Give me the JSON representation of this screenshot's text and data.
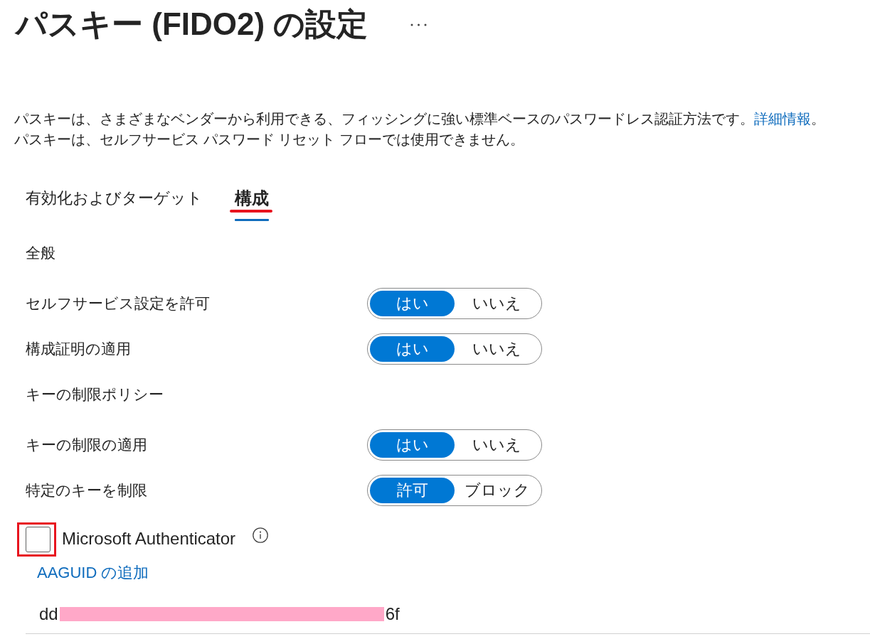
{
  "header": {
    "title": "パスキー (FIDO2) の設定"
  },
  "description": [
    {
      "text": "パスキーは、さまざまなベンダーから利用できる、フィッシングに強い標準ベースのパスワードレス認証方法です。",
      "link": "詳細情報",
      "after_link": "。"
    },
    {
      "text": "パスキーは、セルフサービス パスワード リセット フローでは使用できません。"
    }
  ],
  "tabs": [
    {
      "label": "有効化およびターゲット",
      "selected": false,
      "annotated": false
    },
    {
      "label": "構成",
      "selected": true,
      "annotated": true
    }
  ],
  "settings": [
    {
      "kind": "heading",
      "label": "全般"
    },
    {
      "kind": "toggle",
      "label": "セルフサービス設定を許可",
      "options": [
        {
          "label": "はい",
          "selected": true
        },
        {
          "label": "いいえ",
          "selected": false
        }
      ]
    },
    {
      "kind": "toggle",
      "label": "構成証明の適用",
      "options": [
        {
          "label": "はい",
          "selected": true
        },
        {
          "label": "いいえ",
          "selected": false
        }
      ]
    },
    {
      "kind": "heading",
      "label": "キーの制限ポリシー"
    },
    {
      "kind": "toggle",
      "label": "キーの制限の適用",
      "options": [
        {
          "label": "はい",
          "selected": true
        },
        {
          "label": "いいえ",
          "selected": false
        }
      ]
    },
    {
      "kind": "toggle",
      "label": "特定のキーを制限",
      "options": [
        {
          "label": "許可",
          "selected": true
        },
        {
          "label": "ブロック",
          "selected": false
        }
      ]
    }
  ],
  "keys": [
    {
      "name": "Microsoft Authenticator",
      "checked": false,
      "annotated": true,
      "add_link": "AAGUID の追加",
      "aaguid": {
        "visible_start": "dd",
        "visible_end": "6f",
        "redacted": true
      }
    }
  ]
}
